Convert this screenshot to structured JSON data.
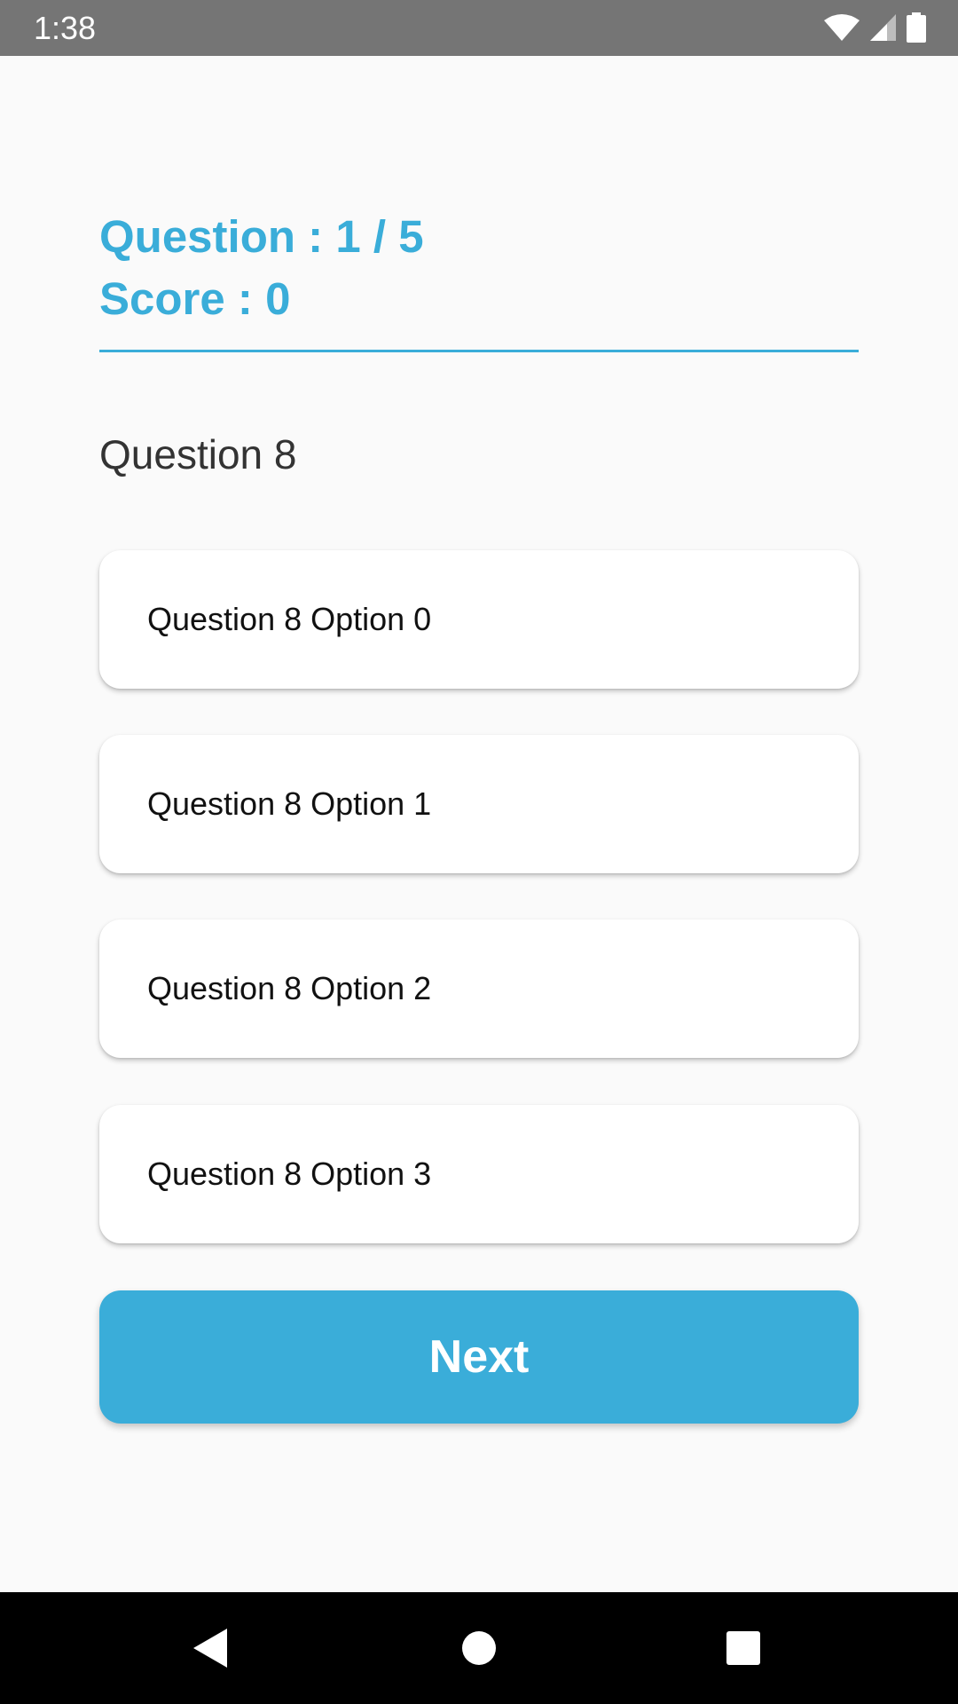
{
  "status_bar": {
    "time": "1:38",
    "icons": [
      "wifi-icon",
      "cell-signal-icon",
      "battery-icon"
    ]
  },
  "quiz": {
    "question_count": "Question : 1 / 5",
    "score": "Score : 0",
    "question_text": "Question 8",
    "options": [
      "Question 8 Option 0",
      "Question 8 Option 1",
      "Question 8 Option 2",
      "Question 8 Option 3"
    ],
    "next_label": "Next"
  },
  "nav_bar": {
    "icons": [
      "back-icon",
      "home-icon",
      "recents-icon"
    ]
  },
  "colors": {
    "accent": "#3aadd9",
    "background": "#fafafa",
    "status_bar": "#757575",
    "nav_bar": "#000000"
  }
}
